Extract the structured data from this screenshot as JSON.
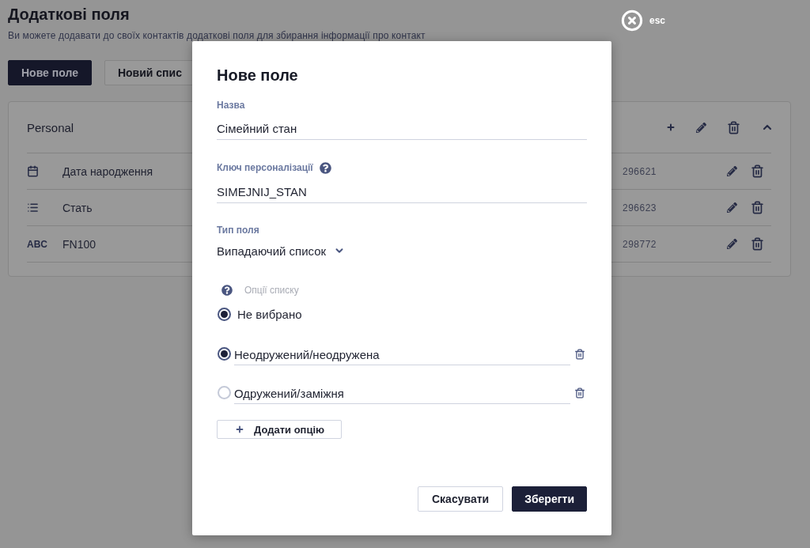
{
  "page": {
    "title": "Додаткові поля",
    "subtitle": "Ви можете додавати до своїх контактів додаткові поля для збирання інформації про контакт",
    "buttons": [
      {
        "label": "Нове поле",
        "kind": "primary"
      },
      {
        "label": "Новий спис",
        "kind": "secondary"
      }
    ]
  },
  "group": {
    "title": "Personal",
    "expanded": true,
    "fields": [
      {
        "kind": "date",
        "name": "Дата народження",
        "number": "296621"
      },
      {
        "kind": "list",
        "name": "Стать",
        "number": "296623"
      },
      {
        "kind": "text",
        "badge": "ABC",
        "name": "FN100",
        "number": "298772"
      }
    ]
  },
  "close": {
    "label": "esc"
  },
  "dialog": {
    "title": "Нове поле",
    "name": {
      "label": "Назва",
      "value": "Сімейний стан"
    },
    "key": {
      "label": "Ключ персоналізації",
      "value": "SIMEJNIJ_STAN"
    },
    "type": {
      "label": "Тип поля",
      "value": "Випадаючий список"
    },
    "options_label": "Опції списку",
    "default_option": {
      "label": "Не вибрано",
      "selected": true
    },
    "options": [
      {
        "value": "Неодружений/неодружена",
        "selected": true
      },
      {
        "value": "Одружений/заміжня",
        "selected": false
      }
    ],
    "add_option": "Додати опцію",
    "buttons": [
      {
        "label": "Скасувати",
        "kind": "secondary"
      },
      {
        "label": "Зберегти",
        "kind": "primary"
      }
    ]
  }
}
